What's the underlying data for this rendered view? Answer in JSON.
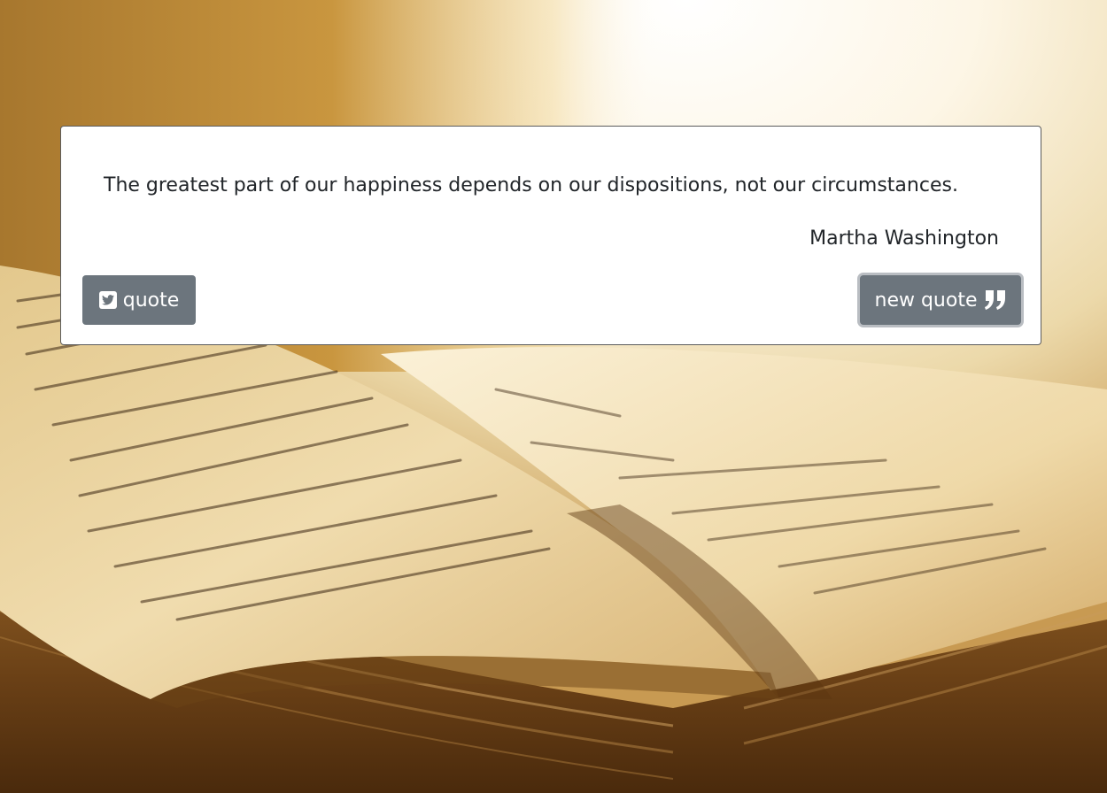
{
  "quote": {
    "text": "The greatest part of our happiness depends on our dispositions, not our circumstances.",
    "author": "Martha Washington"
  },
  "buttons": {
    "tweet_label": "quote",
    "new_quote_label": "new quote"
  },
  "icons": {
    "tweet": "twitter-square-icon",
    "new_quote": "quote-right-icon"
  },
  "colors": {
    "button_bg": "#6c757d",
    "card_bg": "#ffffff",
    "text": "#212529"
  }
}
